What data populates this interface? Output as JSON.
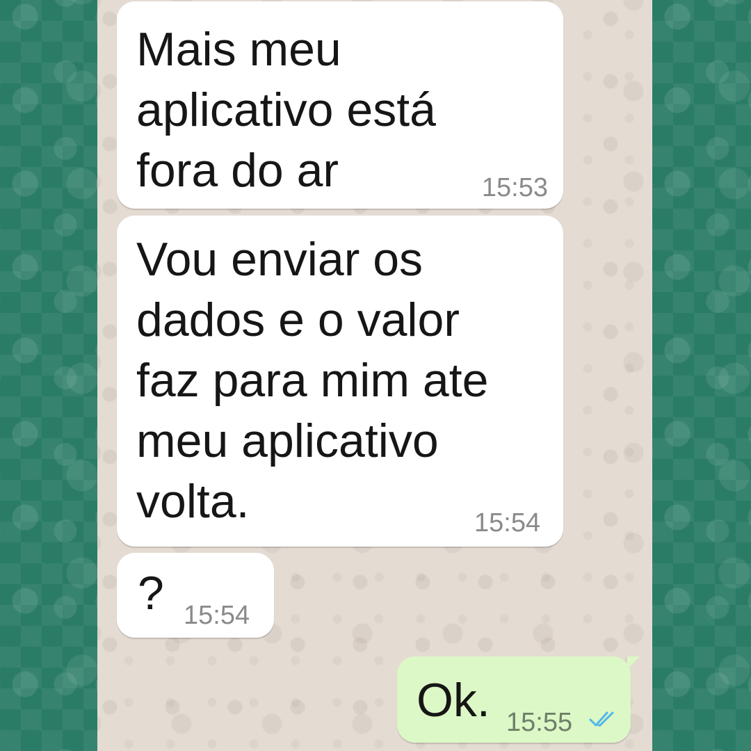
{
  "chat": {
    "messages": [
      {
        "direction": "incoming",
        "text": "Mais meu\naplicativo está\nfora do ar",
        "time": "15:53"
      },
      {
        "direction": "incoming",
        "text": "Vou enviar os\ndados e o valor\nfaz para mim ate\nmeu aplicativo\nvolta.",
        "time": "15:54"
      },
      {
        "direction": "incoming",
        "text": "?",
        "time": "15:54"
      },
      {
        "direction": "outgoing",
        "text": "Ok.",
        "time": "15:55",
        "status_icon": "double-check-read-icon"
      }
    ]
  },
  "colors": {
    "outer_background": "#2b7c67",
    "chat_background": "#e4dcd3",
    "incoming_bubble": "#ffffff",
    "outgoing_bubble": "#dcf8c6",
    "read_tick": "#4fb6ec"
  }
}
